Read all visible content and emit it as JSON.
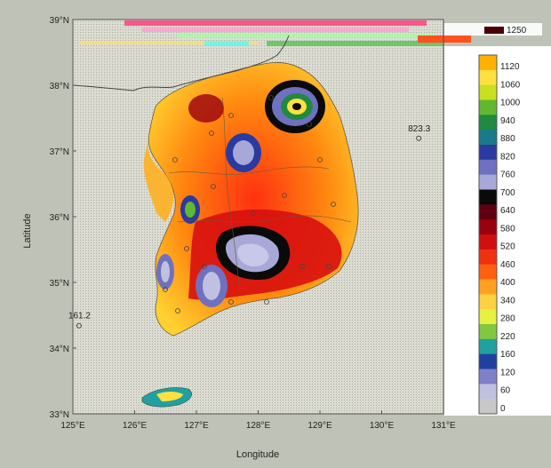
{
  "map": {
    "x_axis_label": "Longitude",
    "y_axis_label": "Latitude",
    "x_ticks": [
      {
        "lon": 125,
        "label": "125°E"
      },
      {
        "lon": 126,
        "label": "126°E"
      },
      {
        "lon": 127,
        "label": "127°E"
      },
      {
        "lon": 128,
        "label": "128°E"
      },
      {
        "lon": 129,
        "label": "129°E"
      },
      {
        "lon": 130,
        "label": "130°E"
      },
      {
        "lon": 131,
        "label": "131°E"
      }
    ],
    "y_ticks": [
      {
        "lat": 33,
        "label": "33°N"
      },
      {
        "lat": 34,
        "label": "34°N"
      },
      {
        "lat": 35,
        "label": "35°N"
      },
      {
        "lat": 36,
        "label": "36°N"
      },
      {
        "lat": 37,
        "label": "37°N"
      },
      {
        "lat": 38,
        "label": "38°N"
      },
      {
        "lat": 39,
        "label": "39°N"
      }
    ],
    "lon_range": [
      125,
      131
    ],
    "lat_range": [
      33,
      39
    ],
    "station_labels": [
      {
        "label": "823.3",
        "lon": 130.6,
        "lat": 37.3
      },
      {
        "label": "161.2",
        "lon": 125.1,
        "lat": 34.45
      }
    ],
    "colorbar_labels": [
      "1120",
      "1060",
      "1000",
      "940",
      "880",
      "820",
      "760",
      "700",
      "640",
      "580",
      "520",
      "460",
      "400",
      "340",
      "280",
      "220",
      "160",
      "120",
      "60",
      "0"
    ],
    "colorbar_colors": [
      "#ffb000",
      "#ffe040",
      "#c8e020",
      "#60b830",
      "#208a40",
      "#1a7a8a",
      "#2a3aa0",
      "#7070c0",
      "#a8a8d8",
      "#0a0a0a",
      "#600010",
      "#9a0010",
      "#d01010",
      "#f03010",
      "#ff6010",
      "#ffa020",
      "#ffd040",
      "#e8f040",
      "#80c840",
      "#20a0a0",
      "#2040a0",
      "#8080c8",
      "#c0c0e0",
      "#c8c8c8"
    ],
    "header_number": "1250",
    "bathy_note": ""
  }
}
